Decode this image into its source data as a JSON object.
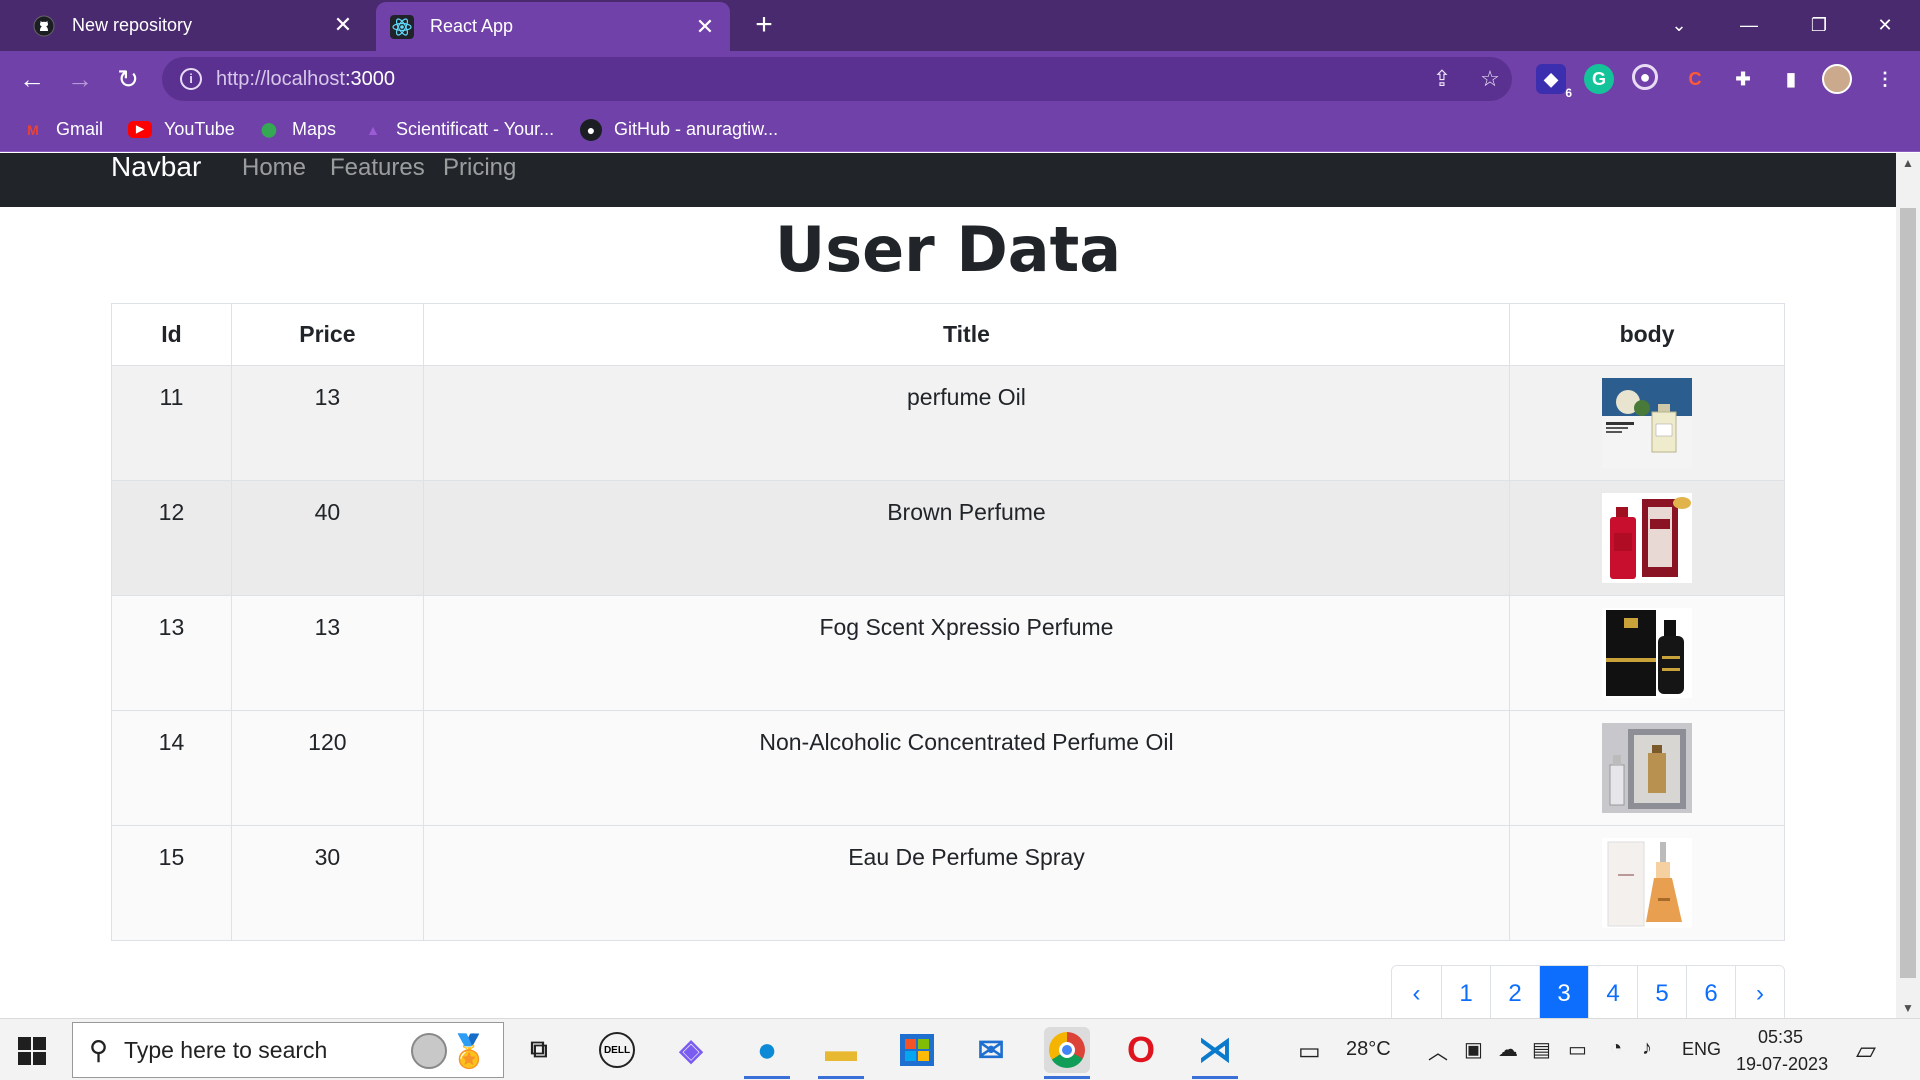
{
  "browser": {
    "tabs": [
      {
        "title": "New repository",
        "icon": "github-icon",
        "active": false
      },
      {
        "title": "React App",
        "icon": "react-icon",
        "active": true
      }
    ],
    "url_host": "http://localhost",
    "url_port": ":3000",
    "bookmarks": [
      {
        "label": "Gmail",
        "icon": "gmail-icon"
      },
      {
        "label": "YouTube",
        "icon": "youtube-icon"
      },
      {
        "label": "Maps",
        "icon": "maps-icon"
      },
      {
        "label": "Scientificatt - Your...",
        "icon": "scientificatt-icon"
      },
      {
        "label": "GitHub - anuragtiw...",
        "icon": "github-icon"
      }
    ],
    "extension_badge": "6"
  },
  "app": {
    "brand": "Navbar",
    "nav": [
      "Home",
      "Features",
      "Pricing"
    ],
    "heading": "User Data",
    "table": {
      "headers": [
        "Id",
        "Price",
        "Title",
        "body"
      ],
      "rows": [
        {
          "id": "11",
          "price": "13",
          "title": "perfume Oil",
          "image": "perfume-oil-image"
        },
        {
          "id": "12",
          "price": "40",
          "title": "Brown Perfume",
          "image": "brown-perfume-image"
        },
        {
          "id": "13",
          "price": "13",
          "title": "Fog Scent Xpressio Perfume",
          "image": "fogg-perfume-image"
        },
        {
          "id": "14",
          "price": "120",
          "title": "Non-Alcoholic Concentrated Perfume Oil",
          "image": "concentrated-oil-image"
        },
        {
          "id": "15",
          "price": "30",
          "title": "Eau De Perfume Spray",
          "image": "perfume-spray-image"
        }
      ]
    },
    "pagination": {
      "prev": "‹",
      "pages": [
        "1",
        "2",
        "3",
        "4",
        "5",
        "6"
      ],
      "active_page": "3",
      "next": "›"
    },
    "colors": {
      "navbar": "#212529",
      "accent": "#0d6efd",
      "browser_frame": "#7041a8"
    }
  },
  "taskbar": {
    "search_placeholder": "Type here to search",
    "weather": "28°C",
    "language": "ENG",
    "time": "05:35",
    "date": "19-07-2023"
  }
}
